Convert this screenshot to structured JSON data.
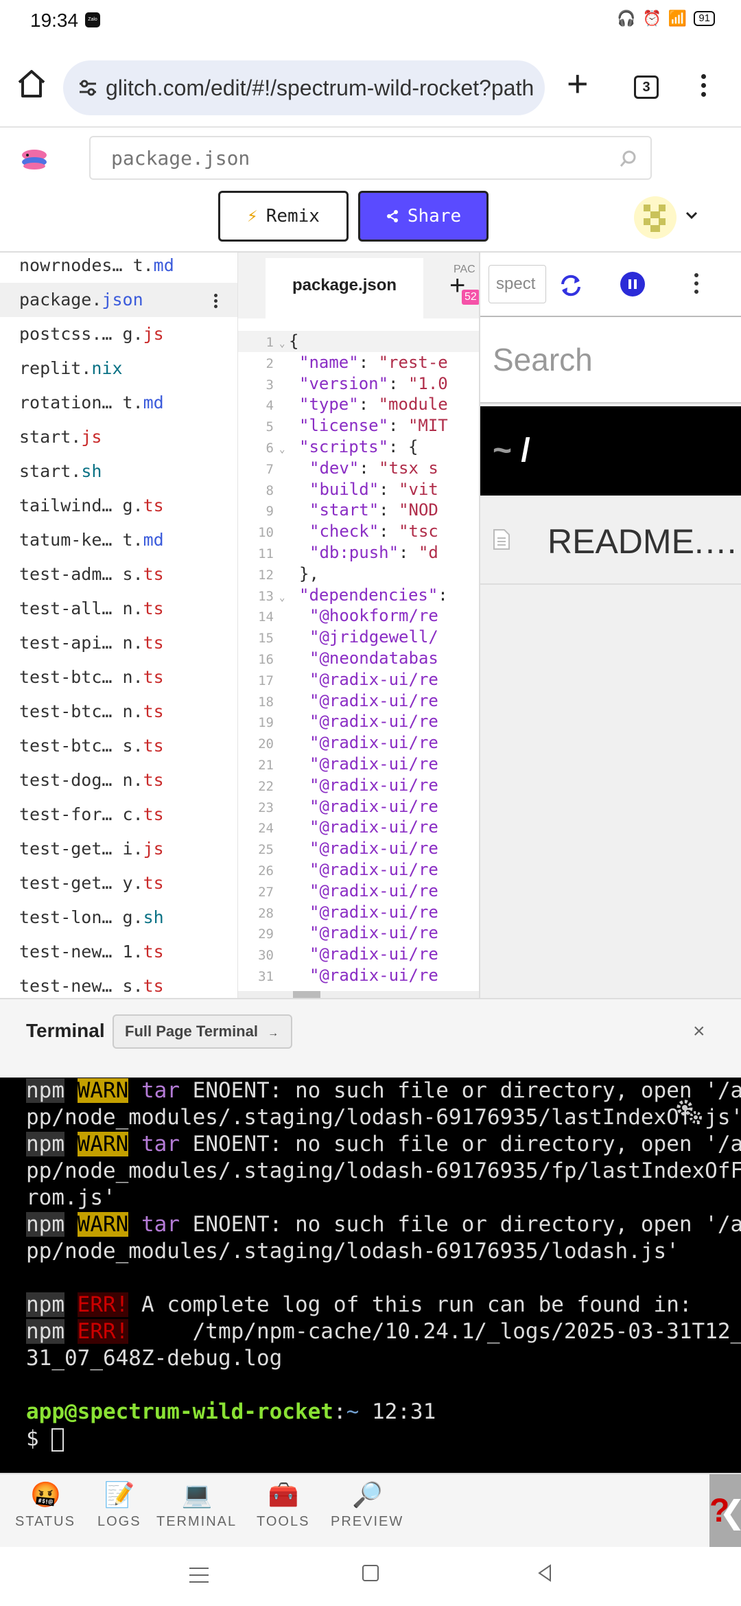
{
  "status_bar": {
    "time": "19:34",
    "battery": "91",
    "app_badge": "Zalo"
  },
  "browser": {
    "url": "glitch.com/edit/#!/spectrum-wild-rocket?path",
    "tab_count": "3"
  },
  "header": {
    "search_placeholder": "package.json",
    "remix_label": "Remix",
    "share_label": "Share"
  },
  "file_tree": [
    {
      "name": "nowrnodes…",
      "suffix": " t.",
      "ext": "md",
      "ext_color": "#3b5bdb"
    },
    {
      "name": "package.",
      "suffix": "",
      "ext": "json",
      "ext_color": "#3b5bdb",
      "active": true
    },
    {
      "name": "postcss.…",
      "suffix": " g.",
      "ext": "js",
      "ext_color": "#c92a2a"
    },
    {
      "name": "replit.",
      "suffix": "",
      "ext": "nix",
      "ext_color": "#0b7285"
    },
    {
      "name": "rotation…",
      "suffix": " t.",
      "ext": "md",
      "ext_color": "#3b5bdb"
    },
    {
      "name": "start.",
      "suffix": "",
      "ext": "js",
      "ext_color": "#c92a2a"
    },
    {
      "name": "start.",
      "suffix": "",
      "ext": "sh",
      "ext_color": "#0b7285"
    },
    {
      "name": "tailwind…",
      "suffix": " g.",
      "ext": "ts",
      "ext_color": "#c92a2a"
    },
    {
      "name": "tatum-ke…",
      "suffix": " t.",
      "ext": "md",
      "ext_color": "#3b5bdb"
    },
    {
      "name": "test-adm…",
      "suffix": " s.",
      "ext": "ts",
      "ext_color": "#c92a2a"
    },
    {
      "name": "test-all…",
      "suffix": " n.",
      "ext": "ts",
      "ext_color": "#c92a2a"
    },
    {
      "name": "test-api…",
      "suffix": " n.",
      "ext": "ts",
      "ext_color": "#c92a2a"
    },
    {
      "name": "test-btc…",
      "suffix": " n.",
      "ext": "ts",
      "ext_color": "#c92a2a"
    },
    {
      "name": "test-btc…",
      "suffix": " n.",
      "ext": "ts",
      "ext_color": "#c92a2a"
    },
    {
      "name": "test-btc…",
      "suffix": " s.",
      "ext": "ts",
      "ext_color": "#c92a2a"
    },
    {
      "name": "test-dog…",
      "suffix": " n.",
      "ext": "ts",
      "ext_color": "#c92a2a"
    },
    {
      "name": "test-for…",
      "suffix": " c.",
      "ext": "ts",
      "ext_color": "#c92a2a"
    },
    {
      "name": "test-get…",
      "suffix": " i.",
      "ext": "js",
      "ext_color": "#c92a2a"
    },
    {
      "name": "test-get…",
      "suffix": " y.",
      "ext": "ts",
      "ext_color": "#c92a2a"
    },
    {
      "name": "test-lon…",
      "suffix": " g.",
      "ext": "sh",
      "ext_color": "#0b7285"
    },
    {
      "name": "test-new…",
      "suffix": " 1.",
      "ext": "ts",
      "ext_color": "#c92a2a"
    },
    {
      "name": "test-new…",
      "suffix": " s.",
      "ext": "ts",
      "ext_color": "#c92a2a"
    }
  ],
  "editor": {
    "tab_label": "package.json",
    "pac_label": "PAC",
    "badge": "52",
    "lines": [
      {
        "n": "1",
        "fold": "⌄",
        "text": "{",
        "kind": "plain",
        "active": true
      },
      {
        "n": "2",
        "key": "\"name\"",
        "val": "\"rest-e"
      },
      {
        "n": "3",
        "key": "\"version\"",
        "val": "\"1.0"
      },
      {
        "n": "4",
        "key": "\"type\"",
        "val": "\"module"
      },
      {
        "n": "5",
        "key": "\"license\"",
        "val": "\"MIT"
      },
      {
        "n": "6",
        "fold": "⌄",
        "key": "\"scripts\"",
        "val": "{"
      },
      {
        "n": "7",
        "indent": 2,
        "key": "\"dev\"",
        "val": "\"tsx s"
      },
      {
        "n": "8",
        "indent": 2,
        "key": "\"build\"",
        "val": "\"vit"
      },
      {
        "n": "9",
        "indent": 2,
        "key": "\"start\"",
        "val": "\"NOD"
      },
      {
        "n": "10",
        "indent": 2,
        "key": "\"check\"",
        "val": "\"tsc"
      },
      {
        "n": "11",
        "indent": 2,
        "key": "\"db:push\"",
        "val": "\"d"
      },
      {
        "n": "12",
        "text": "},",
        "kind": "plain"
      },
      {
        "n": "13",
        "fold": "⌄",
        "key": "\"dependencies\"",
        "val": ""
      },
      {
        "n": "14",
        "indent": 2,
        "text": "\"@hookform/re",
        "kind": "key"
      },
      {
        "n": "15",
        "indent": 2,
        "text": "\"@jridgewell/",
        "kind": "key"
      },
      {
        "n": "16",
        "indent": 2,
        "text": "\"@neondatabas",
        "kind": "key"
      },
      {
        "n": "17",
        "indent": 2,
        "text": "\"@radix-ui/re",
        "kind": "key"
      },
      {
        "n": "18",
        "indent": 2,
        "text": "\"@radix-ui/re",
        "kind": "key"
      },
      {
        "n": "19",
        "indent": 2,
        "text": "\"@radix-ui/re",
        "kind": "key"
      },
      {
        "n": "20",
        "indent": 2,
        "text": "\"@radix-ui/re",
        "kind": "key"
      },
      {
        "n": "21",
        "indent": 2,
        "text": "\"@radix-ui/re",
        "kind": "key"
      },
      {
        "n": "22",
        "indent": 2,
        "text": "\"@radix-ui/re",
        "kind": "key"
      },
      {
        "n": "23",
        "indent": 2,
        "text": "\"@radix-ui/re",
        "kind": "key"
      },
      {
        "n": "24",
        "indent": 2,
        "text": "\"@radix-ui/re",
        "kind": "key"
      },
      {
        "n": "25",
        "indent": 2,
        "text": "\"@radix-ui/re",
        "kind": "key"
      },
      {
        "n": "26",
        "indent": 2,
        "text": "\"@radix-ui/re",
        "kind": "key"
      },
      {
        "n": "27",
        "indent": 2,
        "text": "\"@radix-ui/re",
        "kind": "key"
      },
      {
        "n": "28",
        "indent": 2,
        "text": "\"@radix-ui/re",
        "kind": "key"
      },
      {
        "n": "29",
        "indent": 2,
        "text": "\"@radix-ui/re",
        "kind": "key"
      },
      {
        "n": "30",
        "indent": 2,
        "text": "\"@radix-ui/re",
        "kind": "key"
      },
      {
        "n": "31",
        "indent": 2,
        "text": "\"@radix-ui/re",
        "kind": "key"
      }
    ]
  },
  "preview": {
    "url_value": "spect",
    "search_placeholder": "Search",
    "path_tilde": "~",
    "path_slash": "/",
    "file_name": "README.…"
  },
  "terminal": {
    "title": "Terminal",
    "full_page_label": "Full Page Terminal",
    "full_page_arrow": "→",
    "close": "×",
    "lines": [
      {
        "segs": [
          [
            "npm",
            "npm"
          ],
          [
            " ",
            ""
          ],
          [
            "WARN",
            "warn"
          ],
          [
            " ",
            ""
          ],
          [
            "tar",
            "tar"
          ],
          [
            " ENOENT: no such file or directory, open '/a",
            ""
          ]
        ]
      },
      {
        "segs": [
          [
            "pp/node_modules/.staging/lodash-69176935/lastIndexOf.js'",
            ""
          ]
        ]
      },
      {
        "segs": [
          [
            "npm",
            "npm"
          ],
          [
            " ",
            ""
          ],
          [
            "WARN",
            "warn"
          ],
          [
            " ",
            ""
          ],
          [
            "tar",
            "tar"
          ],
          [
            " ENOENT: no such file or directory, open '/a",
            ""
          ]
        ]
      },
      {
        "segs": [
          [
            "pp/node_modules/.staging/lodash-69176935/fp/lastIndexOfF",
            ""
          ]
        ]
      },
      {
        "segs": [
          [
            "rom.js'",
            ""
          ]
        ]
      },
      {
        "segs": [
          [
            "npm",
            "npm"
          ],
          [
            " ",
            ""
          ],
          [
            "WARN",
            "warn"
          ],
          [
            " ",
            ""
          ],
          [
            "tar",
            "tar"
          ],
          [
            " ENOENT: no such file or directory, open '/a",
            ""
          ]
        ]
      },
      {
        "segs": [
          [
            "pp/node_modules/.staging/lodash-69176935/lodash.js'",
            ""
          ]
        ]
      },
      {
        "segs": [
          [
            "",
            ""
          ]
        ]
      },
      {
        "segs": [
          [
            "npm",
            "npm"
          ],
          [
            " ",
            ""
          ],
          [
            "ERR!",
            "err"
          ],
          [
            " A complete log of this run can be found in:",
            ""
          ]
        ]
      },
      {
        "segs": [
          [
            "npm",
            "npm"
          ],
          [
            " ",
            ""
          ],
          [
            "ERR!",
            "err"
          ],
          [
            "     /tmp/npm-cache/10.24.1/_logs/2025-03-31T12_",
            ""
          ]
        ]
      },
      {
        "segs": [
          [
            "31_07_648Z-debug.log",
            ""
          ]
        ]
      },
      {
        "segs": [
          [
            "",
            ""
          ]
        ]
      },
      {
        "segs": [
          [
            "app@spectrum-wild-rocket",
            "user"
          ],
          [
            ":",
            ""
          ],
          [
            "~",
            "tilde"
          ],
          [
            " 12:31",
            ""
          ]
        ]
      }
    ],
    "prompt": "$"
  },
  "toolbar": [
    {
      "label": "STATUS",
      "icon": "🤬"
    },
    {
      "label": "LOGS",
      "icon": "📝"
    },
    {
      "label": "TERMINAL",
      "icon": "💻"
    },
    {
      "label": "TOOLS",
      "icon": "🧰"
    },
    {
      "label": "PREVIEW",
      "icon": "🔎"
    }
  ],
  "help": {
    "q": "?",
    "chevron": "❮"
  },
  "colors": {
    "accent": "#5a4bff",
    "terminal_bg": "#000000",
    "warn": "#c4a000",
    "err": "#cc0000",
    "prompt_user": "#8ae234"
  }
}
